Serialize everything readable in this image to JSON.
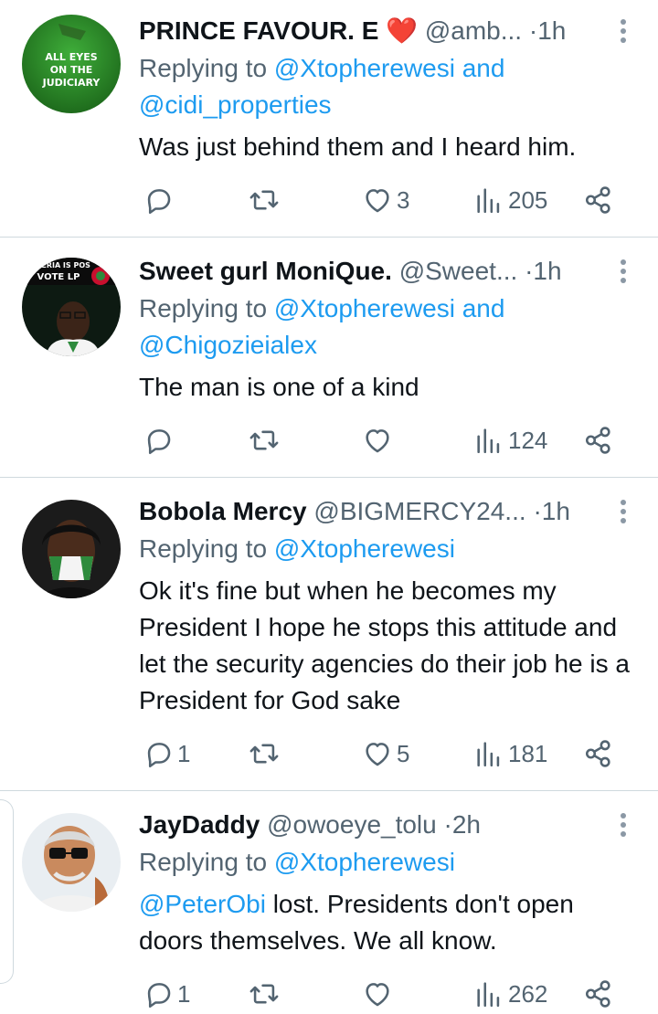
{
  "tweets": [
    {
      "name": "PRINCE FAVOUR. E",
      "emoji": "❤️",
      "handle": "@amb...",
      "time": "1h",
      "avatar_text": "ALL EYES ON THE JUDICIARY",
      "reply_prefix": "Replying to",
      "reply_to_1": "@Xtopherewesi",
      "reply_joiner": "and",
      "reply_to_2": "@cidi_properties",
      "body": "Was just behind them and I heard him.",
      "replies": "",
      "retweets": "",
      "likes": "3",
      "views": "205"
    },
    {
      "name": "Sweet gurl MoniQue.",
      "handle": "@Sweet...",
      "time": "1h",
      "avatar_text": "NIGERIA IS POS VOTE LP",
      "reply_prefix": "Replying to",
      "reply_to_1": "@Xtopherewesi",
      "reply_joiner": "and",
      "reply_to_2": "@Chigozieialex",
      "body": "The man is one of a kind",
      "replies": "",
      "retweets": "",
      "likes": "",
      "views": "124"
    },
    {
      "name": "Bobola Mercy",
      "handle": "@BIGMERCY24...",
      "time": "1h",
      "reply_prefix": "Replying to",
      "reply_to_1": "@Xtopherewesi",
      "body": "Ok it's fine but when he becomes my President I hope he stops this attitude and let the security agencies do their job he is a President for God sake",
      "replies": "1",
      "retweets": "",
      "likes": "5",
      "views": "181"
    },
    {
      "name": "JayDaddy",
      "handle": "@owoeye_tolu",
      "time": "2h",
      "reply_prefix": "Replying to",
      "reply_to_1": "@Xtopherewesi",
      "body_mention": "@PeterObi",
      "body": " lost. Presidents don't open doors themselves. We all know.",
      "replies": "1",
      "retweets": "",
      "likes": "",
      "views": "262"
    }
  ],
  "separator": "·",
  "icons": [
    "reply-icon",
    "retweet-icon",
    "like-icon",
    "views-icon",
    "share-icon",
    "more-icon"
  ],
  "colors": {
    "link": "#1d9bf0",
    "muted": "#536471",
    "text": "#0f1419",
    "divider": "#cfd9de"
  }
}
